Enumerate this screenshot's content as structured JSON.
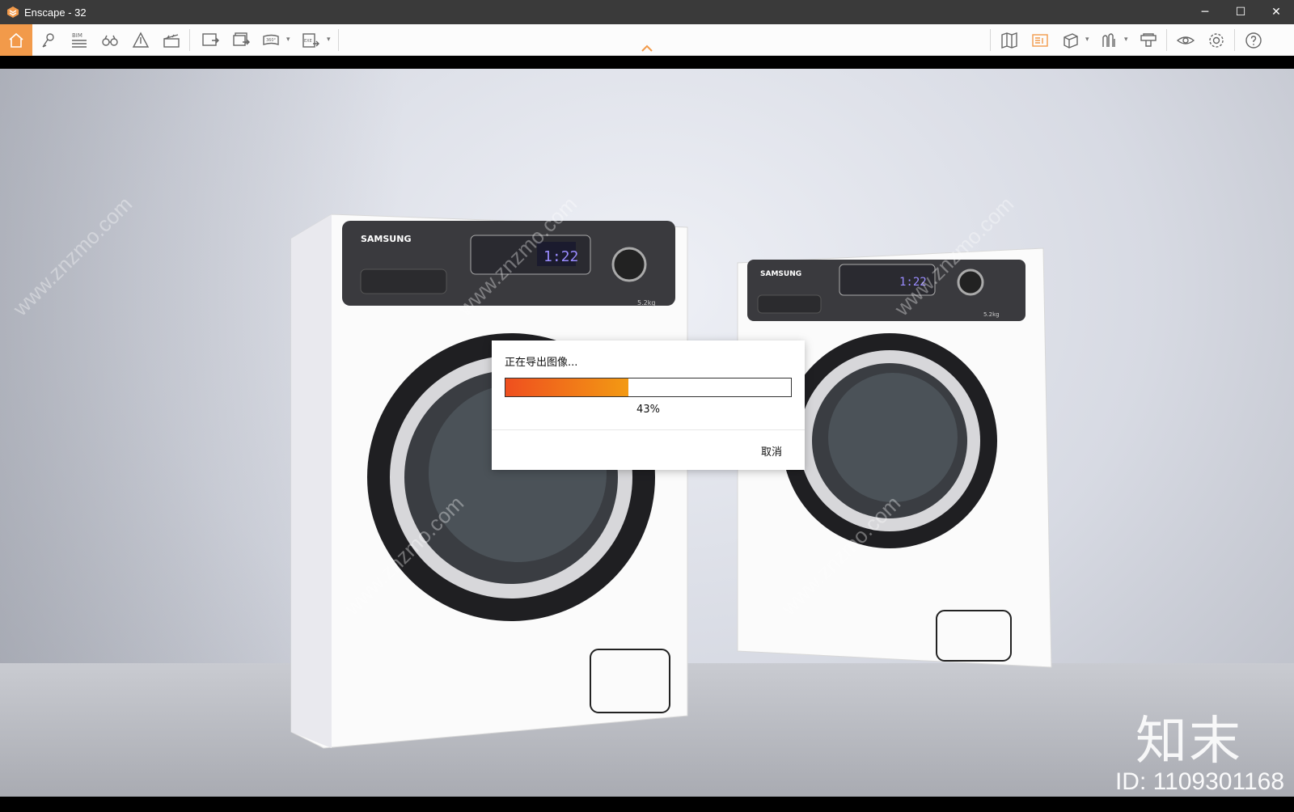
{
  "window": {
    "title": "Enscape - 32",
    "minimize_glyph": "─",
    "maximize_glyph": "☐",
    "close_glyph": "✕"
  },
  "toolbar": {
    "left_icons": [
      "home-icon",
      "asset-library-icon",
      "bim-icon",
      "binoculars-icon",
      "sketch-mode-icon",
      "video-editor-icon",
      "screenshot-icon",
      "batch-render-icon",
      "panorama-360-icon",
      "export-exe-icon"
    ],
    "right_icons": [
      "map-icon",
      "view-management-icon",
      "cube-view-icon",
      "light-view-icon",
      "material-editor-icon",
      "visual-settings-eye-icon",
      "settings-icon",
      "help-icon"
    ],
    "bim_label": "BIM",
    "pano_label": "360°",
    "exe_label": "EXE",
    "accent_color": "#f29a4a"
  },
  "dialog": {
    "message": "正在导出图像...",
    "progress_percent": 43,
    "progress_label": "43%",
    "cancel_label": "取消"
  },
  "viewport": {
    "brand_text": "SAMSUNG",
    "display_text": "1:22",
    "capacity_text": "5.2kg",
    "watermark_site": "www.znzmo.com",
    "watermark_logo": "知末",
    "watermark_id": "ID: 1109301168"
  }
}
